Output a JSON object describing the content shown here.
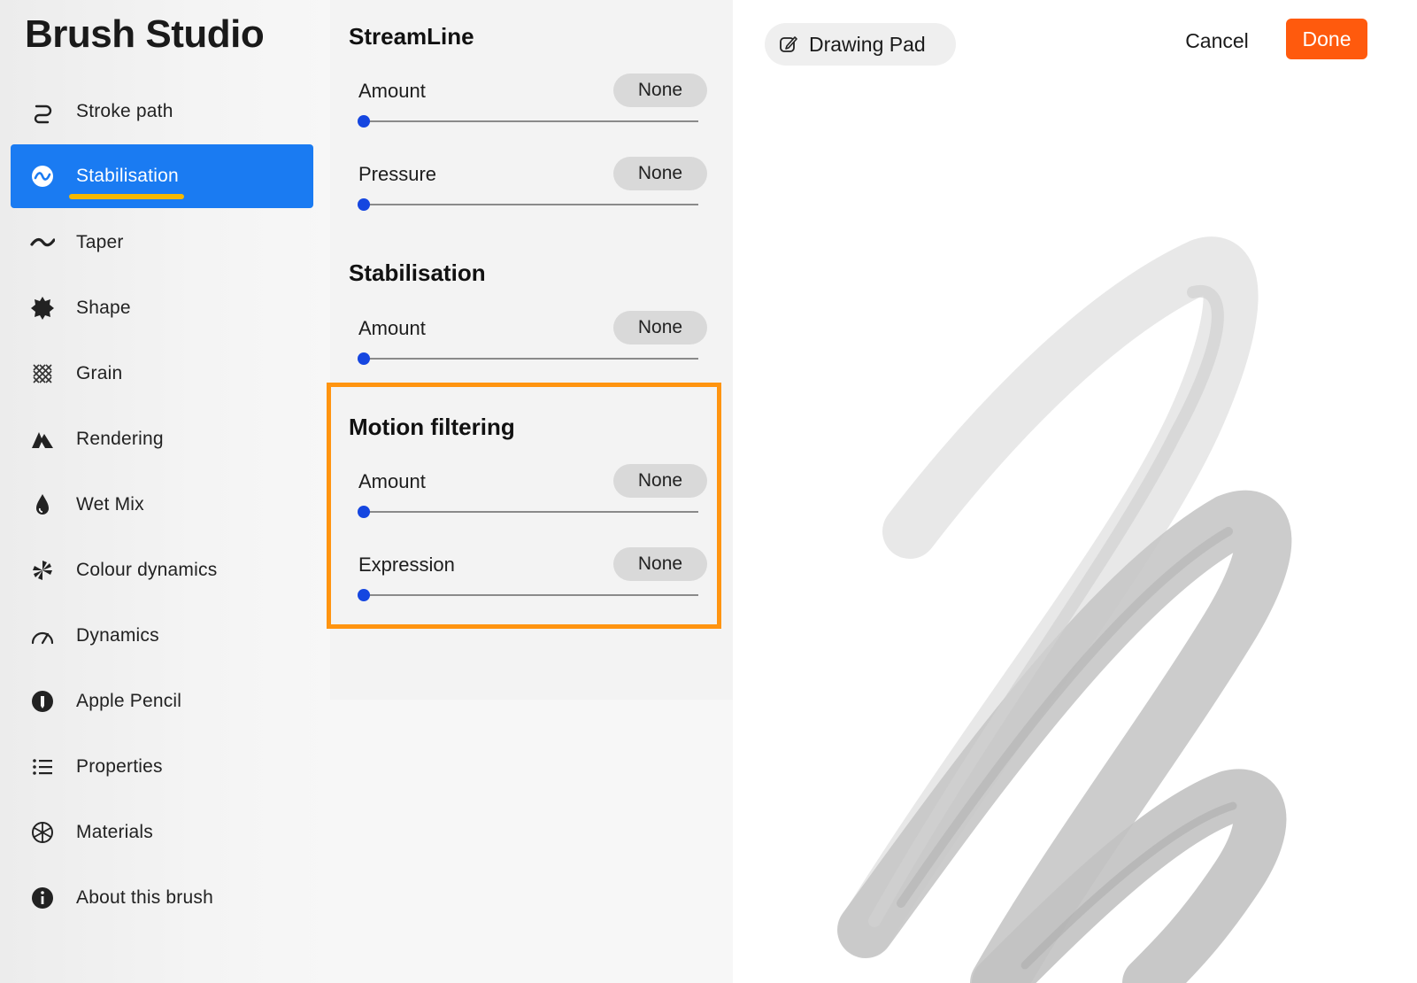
{
  "app": {
    "title": "Brush Studio"
  },
  "sidebar": {
    "items": [
      {
        "label": "Stroke path",
        "icon": "stroke-path-icon",
        "active": false
      },
      {
        "label": "Stabilisation",
        "icon": "stabilisation-icon",
        "active": true
      },
      {
        "label": "Taper",
        "icon": "taper-icon",
        "active": false
      },
      {
        "label": "Shape",
        "icon": "shape-icon",
        "active": false
      },
      {
        "label": "Grain",
        "icon": "grain-icon",
        "active": false
      },
      {
        "label": "Rendering",
        "icon": "rendering-icon",
        "active": false
      },
      {
        "label": "Wet Mix",
        "icon": "wet-mix-icon",
        "active": false
      },
      {
        "label": "Colour dynamics",
        "icon": "colour-dynamics-icon",
        "active": false
      },
      {
        "label": "Dynamics",
        "icon": "dynamics-icon",
        "active": false
      },
      {
        "label": "Apple Pencil",
        "icon": "apple-pencil-icon",
        "active": false
      },
      {
        "label": "Properties",
        "icon": "properties-icon",
        "active": false
      },
      {
        "label": "Materials",
        "icon": "materials-icon",
        "active": false
      },
      {
        "label": "About this brush",
        "icon": "info-icon",
        "active": false
      }
    ]
  },
  "settings": {
    "streamline": {
      "title": "StreamLine",
      "amount": {
        "label": "Amount",
        "value": "None",
        "slider": 0
      },
      "pressure": {
        "label": "Pressure",
        "value": "None",
        "slider": 0
      }
    },
    "stabilisation": {
      "title": "Stabilisation",
      "amount": {
        "label": "Amount",
        "value": "None",
        "slider": 0
      }
    },
    "motion_filtering": {
      "title": "Motion filtering",
      "amount": {
        "label": "Amount",
        "value": "None",
        "slider": 0
      },
      "expression": {
        "label": "Expression",
        "value": "None",
        "slider": 0
      }
    }
  },
  "header": {
    "drawing_pad_label": "Drawing Pad",
    "cancel_label": "Cancel",
    "done_label": "Done"
  },
  "colors": {
    "accent": "#1a7bf2",
    "done": "#ff5a0d",
    "highlight_box": "#ff9410",
    "underline": "#f5b800",
    "slider_knob": "#1546e0"
  }
}
